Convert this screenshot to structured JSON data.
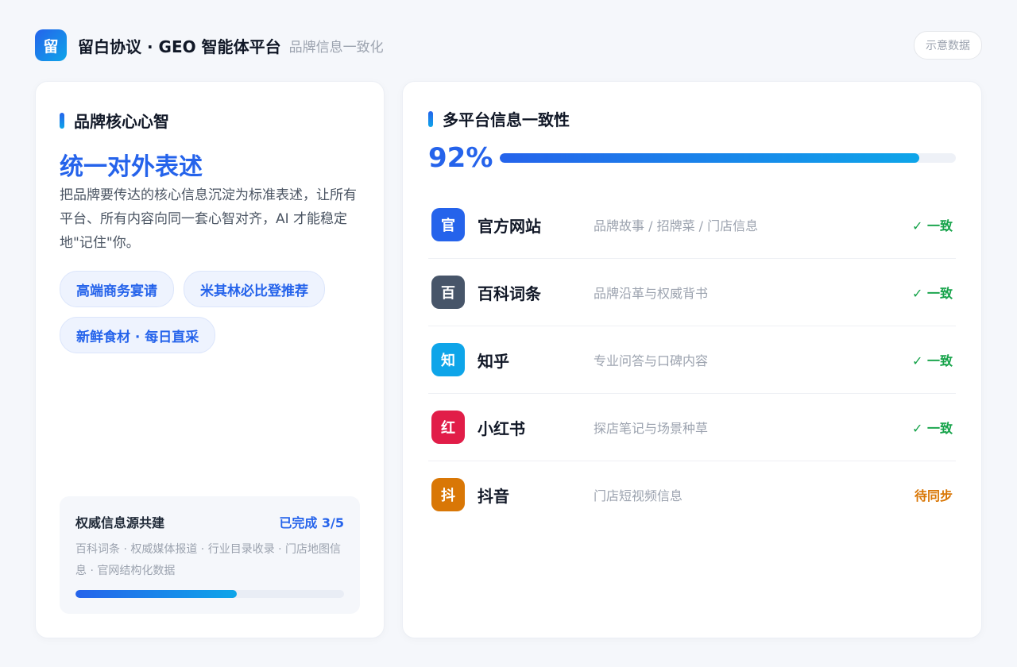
{
  "header": {
    "logo_char": "留",
    "title": "留白协议 · GEO 智能体平台",
    "subtitle": "品牌信息一致化",
    "badge": "示意数据"
  },
  "left": {
    "section_title": "品牌核心心智",
    "headline": "统一对外表述",
    "description": "把品牌要传达的核心信息沉淀为标准表述，让所有平台、所有内容向同一套心智对齐，AI 才能稳定地\"记住\"你。",
    "tags": [
      "高端商务宴请",
      "米其林必比登推荐",
      "新鲜食材 · 每日直采"
    ],
    "authority": {
      "title": "权威信息源共建",
      "status": "已完成 3/5",
      "description": "百科词条 · 权威媒体报道 · 行业目录收录 · 门店地图信息 · 官网结构化数据",
      "progress_fraction": 0.6
    }
  },
  "right": {
    "section_title": "多平台信息一致性",
    "percent_label": "92%",
    "percent_value": 0.92,
    "platforms": [
      {
        "icon": "官",
        "name": "官方网站",
        "desc": "品牌故事 / 招牌菜 / 门店信息",
        "status": "✓ 一致",
        "color": "#2563eb",
        "status_color": "#16a34a"
      },
      {
        "icon": "百",
        "name": "百科词条",
        "desc": "品牌沿革与权威背书",
        "status": "✓ 一致",
        "color": "#475569",
        "status_color": "#16a34a"
      },
      {
        "icon": "知",
        "name": "知乎",
        "desc": "专业问答与口碑内容",
        "status": "✓ 一致",
        "color": "#0ea5e9",
        "status_color": "#16a34a"
      },
      {
        "icon": "红",
        "name": "小红书",
        "desc": "探店笔记与场景种草",
        "status": "✓ 一致",
        "color": "#e11d48",
        "status_color": "#16a34a"
      },
      {
        "icon": "抖",
        "name": "抖音",
        "desc": "门店短视频信息",
        "status": "待同步",
        "color": "#d97706",
        "status_color": "#d97706"
      }
    ]
  }
}
